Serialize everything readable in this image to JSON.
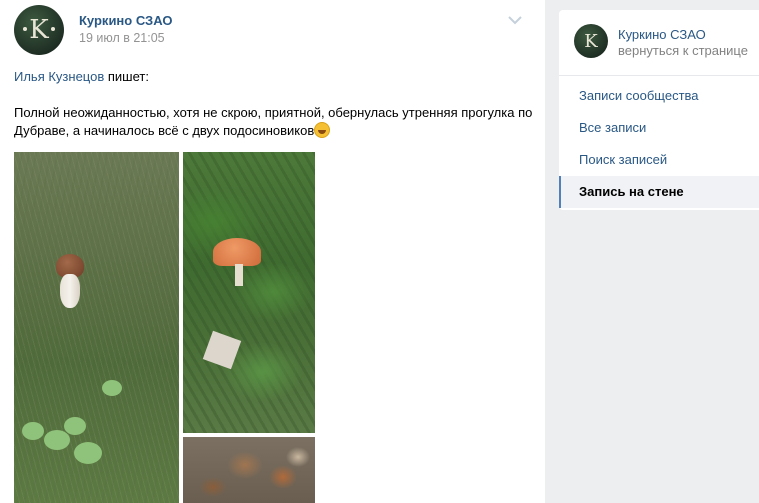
{
  "post": {
    "group_name": "Куркино СЗАО",
    "date": "19 июл в 21:05",
    "repost_author": "Илья Кузнецов",
    "repost_verb": " пишет:",
    "text": "Полной неожиданностью, хотя не скрою, приятной, обернулась утренняя прогулка по Дубраве, а начиналось всё с двух подосиновиков",
    "avatar_letter": "K",
    "emoji": "grinning-face",
    "photos": [
      "mushroom-in-grass",
      "mushroom-among-leaves",
      "basket-of-mushrooms"
    ]
  },
  "sidebar": {
    "group_name": "Куркино СЗАО",
    "back_label": "вернуться к странице",
    "avatar_letter": "K",
    "menu": [
      {
        "label": "Записи сообщества",
        "active": false
      },
      {
        "label": "Все записи",
        "active": false
      },
      {
        "label": "Поиск записей",
        "active": false
      },
      {
        "label": "Запись на стене",
        "active": true
      }
    ]
  },
  "colors": {
    "link": "#2a5885",
    "background": "#edeef0",
    "active_marker": "#5181b8"
  }
}
